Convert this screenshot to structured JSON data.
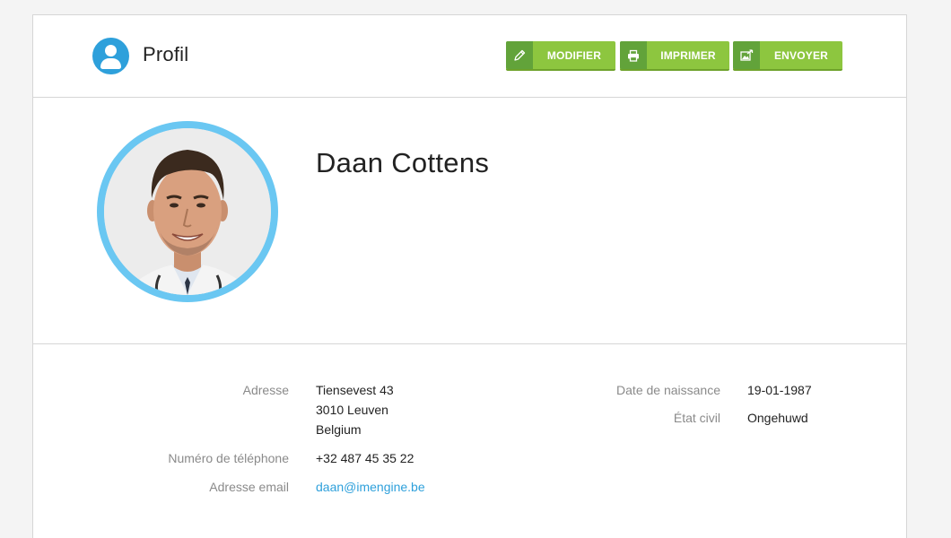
{
  "header": {
    "title": "Profil",
    "buttons": {
      "modifier": "MODIFIER",
      "imprimer": "IMPRIMER",
      "envoyer": "ENVOYER"
    }
  },
  "profile": {
    "name": "Daan Cottens"
  },
  "details": {
    "address_label": "Adresse",
    "address_line1": "Tiensevest 43",
    "address_line2": "3010 Leuven",
    "address_line3": "Belgium",
    "phone_label": "Numéro de téléphone",
    "phone": "+32 487 45 35 22",
    "email_label": "Adresse email",
    "email": "daan@imengine.be",
    "birth_label": "Date de naissance",
    "birth": "19-01-1987",
    "civil_label": "État civil",
    "civil": "Ongehuwd"
  },
  "colors": {
    "accent": "#2ea0db",
    "button": "#8dc63f",
    "button_icon": "#62a33a",
    "avatar_ring": "#6ac7f2"
  },
  "icons": {
    "header": "user-icon",
    "modifier": "pencil-icon",
    "imprimer": "printer-icon",
    "envoyer": "send-image-icon"
  }
}
